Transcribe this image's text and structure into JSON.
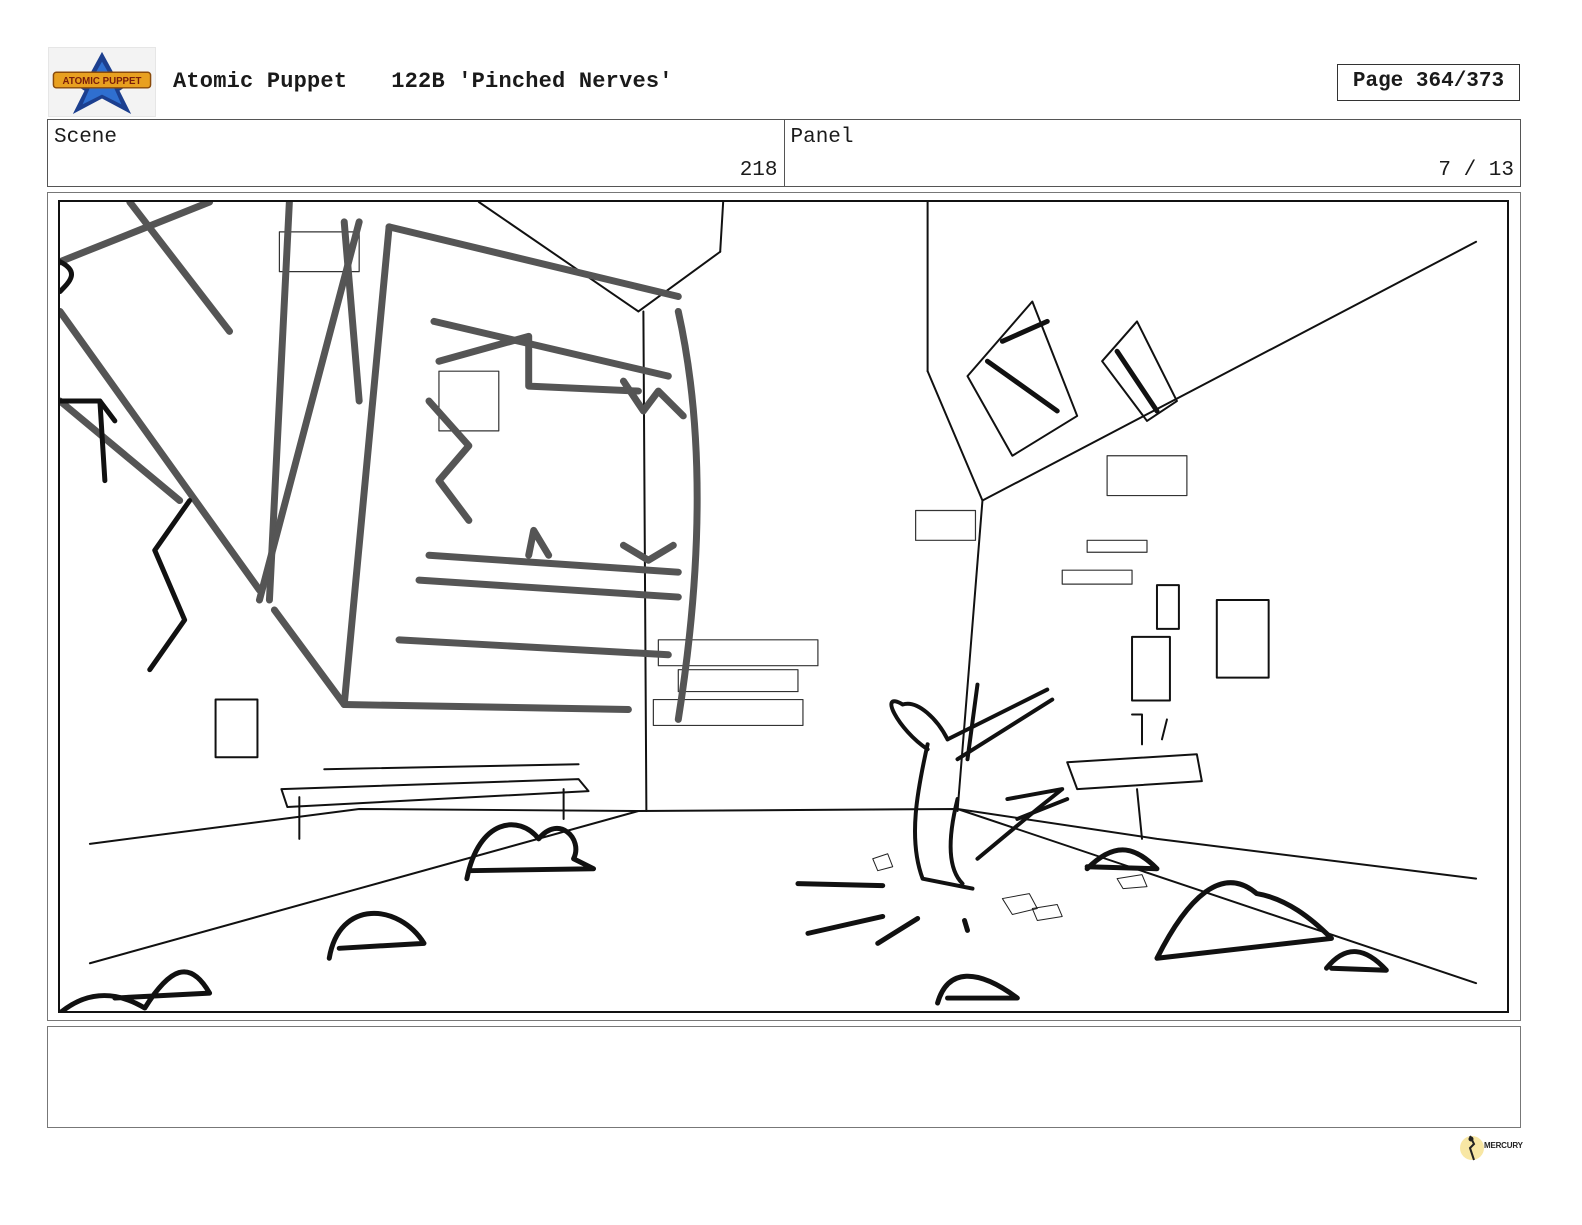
{
  "header": {
    "show_title": "Atomic Puppet",
    "episode_title": "122B 'Pinched Nerves'",
    "page_label": "Page 364/373",
    "logo_text": "ATOMIC PUPPET"
  },
  "info": {
    "scene_label": "Scene",
    "scene_value": "218",
    "panel_label": "Panel",
    "panel_value": "7 / 13"
  },
  "panel": {
    "image_name": "storyboard-sketch"
  },
  "notes": {
    "text": ""
  },
  "footer": {
    "studio_logo_text": "MERCURY"
  },
  "colors": {
    "logo_gold": "#e8a020",
    "logo_blue": "#1c3f8f",
    "sketch_black": "#111111",
    "sketch_grey": "#555555"
  }
}
